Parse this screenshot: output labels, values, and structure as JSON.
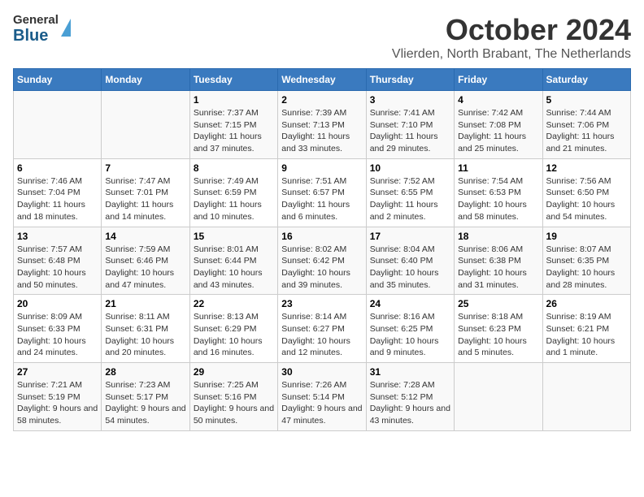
{
  "header": {
    "logo_general": "General",
    "logo_blue": "Blue",
    "month": "October 2024",
    "location": "Vlierden, North Brabant, The Netherlands"
  },
  "days_of_week": [
    "Sunday",
    "Monday",
    "Tuesday",
    "Wednesday",
    "Thursday",
    "Friday",
    "Saturday"
  ],
  "weeks": [
    [
      {
        "day": "",
        "info": ""
      },
      {
        "day": "",
        "info": ""
      },
      {
        "day": "1",
        "info": "Sunrise: 7:37 AM\nSunset: 7:15 PM\nDaylight: 11 hours and 37 minutes."
      },
      {
        "day": "2",
        "info": "Sunrise: 7:39 AM\nSunset: 7:13 PM\nDaylight: 11 hours and 33 minutes."
      },
      {
        "day": "3",
        "info": "Sunrise: 7:41 AM\nSunset: 7:10 PM\nDaylight: 11 hours and 29 minutes."
      },
      {
        "day": "4",
        "info": "Sunrise: 7:42 AM\nSunset: 7:08 PM\nDaylight: 11 hours and 25 minutes."
      },
      {
        "day": "5",
        "info": "Sunrise: 7:44 AM\nSunset: 7:06 PM\nDaylight: 11 hours and 21 minutes."
      }
    ],
    [
      {
        "day": "6",
        "info": "Sunrise: 7:46 AM\nSunset: 7:04 PM\nDaylight: 11 hours and 18 minutes."
      },
      {
        "day": "7",
        "info": "Sunrise: 7:47 AM\nSunset: 7:01 PM\nDaylight: 11 hours and 14 minutes."
      },
      {
        "day": "8",
        "info": "Sunrise: 7:49 AM\nSunset: 6:59 PM\nDaylight: 11 hours and 10 minutes."
      },
      {
        "day": "9",
        "info": "Sunrise: 7:51 AM\nSunset: 6:57 PM\nDaylight: 11 hours and 6 minutes."
      },
      {
        "day": "10",
        "info": "Sunrise: 7:52 AM\nSunset: 6:55 PM\nDaylight: 11 hours and 2 minutes."
      },
      {
        "day": "11",
        "info": "Sunrise: 7:54 AM\nSunset: 6:53 PM\nDaylight: 10 hours and 58 minutes."
      },
      {
        "day": "12",
        "info": "Sunrise: 7:56 AM\nSunset: 6:50 PM\nDaylight: 10 hours and 54 minutes."
      }
    ],
    [
      {
        "day": "13",
        "info": "Sunrise: 7:57 AM\nSunset: 6:48 PM\nDaylight: 10 hours and 50 minutes."
      },
      {
        "day": "14",
        "info": "Sunrise: 7:59 AM\nSunset: 6:46 PM\nDaylight: 10 hours and 47 minutes."
      },
      {
        "day": "15",
        "info": "Sunrise: 8:01 AM\nSunset: 6:44 PM\nDaylight: 10 hours and 43 minutes."
      },
      {
        "day": "16",
        "info": "Sunrise: 8:02 AM\nSunset: 6:42 PM\nDaylight: 10 hours and 39 minutes."
      },
      {
        "day": "17",
        "info": "Sunrise: 8:04 AM\nSunset: 6:40 PM\nDaylight: 10 hours and 35 minutes."
      },
      {
        "day": "18",
        "info": "Sunrise: 8:06 AM\nSunset: 6:38 PM\nDaylight: 10 hours and 31 minutes."
      },
      {
        "day": "19",
        "info": "Sunrise: 8:07 AM\nSunset: 6:35 PM\nDaylight: 10 hours and 28 minutes."
      }
    ],
    [
      {
        "day": "20",
        "info": "Sunrise: 8:09 AM\nSunset: 6:33 PM\nDaylight: 10 hours and 24 minutes."
      },
      {
        "day": "21",
        "info": "Sunrise: 8:11 AM\nSunset: 6:31 PM\nDaylight: 10 hours and 20 minutes."
      },
      {
        "day": "22",
        "info": "Sunrise: 8:13 AM\nSunset: 6:29 PM\nDaylight: 10 hours and 16 minutes."
      },
      {
        "day": "23",
        "info": "Sunrise: 8:14 AM\nSunset: 6:27 PM\nDaylight: 10 hours and 12 minutes."
      },
      {
        "day": "24",
        "info": "Sunrise: 8:16 AM\nSunset: 6:25 PM\nDaylight: 10 hours and 9 minutes."
      },
      {
        "day": "25",
        "info": "Sunrise: 8:18 AM\nSunset: 6:23 PM\nDaylight: 10 hours and 5 minutes."
      },
      {
        "day": "26",
        "info": "Sunrise: 8:19 AM\nSunset: 6:21 PM\nDaylight: 10 hours and 1 minute."
      }
    ],
    [
      {
        "day": "27",
        "info": "Sunrise: 7:21 AM\nSunset: 5:19 PM\nDaylight: 9 hours and 58 minutes."
      },
      {
        "day": "28",
        "info": "Sunrise: 7:23 AM\nSunset: 5:17 PM\nDaylight: 9 hours and 54 minutes."
      },
      {
        "day": "29",
        "info": "Sunrise: 7:25 AM\nSunset: 5:16 PM\nDaylight: 9 hours and 50 minutes."
      },
      {
        "day": "30",
        "info": "Sunrise: 7:26 AM\nSunset: 5:14 PM\nDaylight: 9 hours and 47 minutes."
      },
      {
        "day": "31",
        "info": "Sunrise: 7:28 AM\nSunset: 5:12 PM\nDaylight: 9 hours and 43 minutes."
      },
      {
        "day": "",
        "info": ""
      },
      {
        "day": "",
        "info": ""
      }
    ]
  ]
}
